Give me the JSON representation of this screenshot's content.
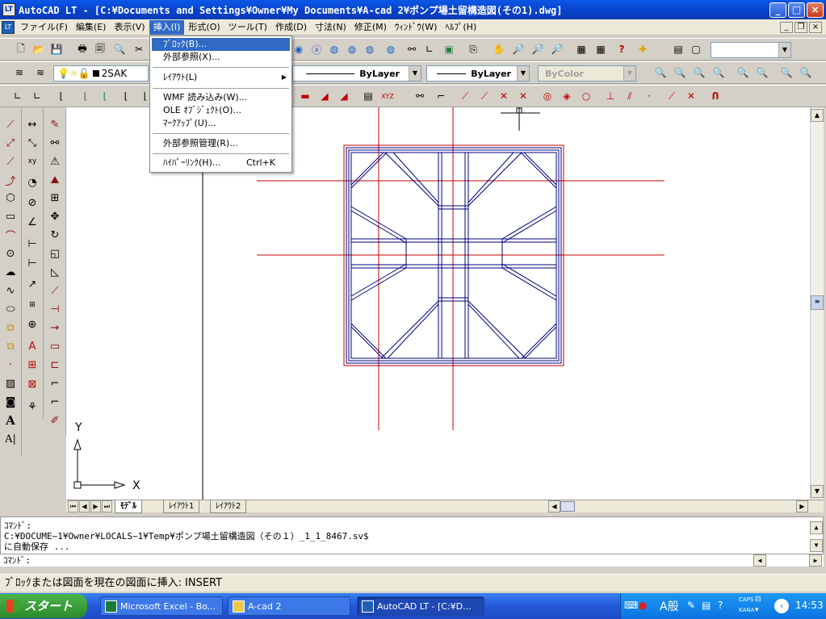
{
  "window": {
    "title": "AutoCAD LT - [C:¥Documents and Settings¥Owner¥My Documents¥A-cad 2¥ポンプ場土留構造図(その1).dwg]",
    "icon": "autocad-app-icon"
  },
  "menubar": {
    "items": [
      "ファイル(F)",
      "編集(E)",
      "表示(V)",
      "挿入(I)",
      "形式(O)",
      "ツール(T)",
      "作成(D)",
      "寸法(N)",
      "修正(M)",
      "ｳｨﾝﾄﾞｳ(W)",
      "ﾍﾙﾌﾟ(H)"
    ],
    "active_index": 3
  },
  "insert_menu": {
    "items": [
      {
        "label": "ﾌﾞﾛｯｸ(B)...",
        "highlighted": true
      },
      {
        "label": "外部参照(X)..."
      },
      {
        "label": "ﾚｲｱｳﾄ(L)",
        "submenu": true
      },
      {
        "label": "WMF 読み込み(W)..."
      },
      {
        "label": "OLE ｵﾌﾞｼﾞｪｸﾄ(O)..."
      },
      {
        "label": "ﾏｰｸｱｯﾌﾟ(U)..."
      },
      {
        "label": "外部参照管理(R)..."
      },
      {
        "label": "ﾊｲﾊﾟｰﾘﾝｸ(H)...",
        "shortcut": "Ctrl+K"
      }
    ]
  },
  "properties": {
    "layer": "2SAK",
    "linetype": "ByLayer",
    "lineweight": "ByLayer",
    "color": "ByColor"
  },
  "ucs": {
    "x_label": "X",
    "y_label": "Y"
  },
  "layout_tabs": [
    {
      "label": "ﾓﾃﾞﾙ",
      "selected": true
    },
    {
      "label": "ﾚｲｱｳﾄ1"
    },
    {
      "label": "ﾚｲｱｳﾄ2"
    }
  ],
  "command": {
    "lines": [
      "ｺﾏﾝﾄﾞ:",
      "C:¥DOCUME~1¥Owner¥LOCALS~1¥Temp¥ポンプ場土留構造図（その１）_1_1_8467.sv$",
      "に自動保存 ..."
    ],
    "prompt": "ｺﾏﾝﾄﾞ:"
  },
  "status_text": "ﾌﾞﾛｯｸまたは図面を現在の図面に挿入:  INSERT",
  "taskbar": {
    "start_label": "スタート",
    "tasks": [
      {
        "label": "Microsoft Excel - Bo...",
        "icon": "excel-icon"
      },
      {
        "label": "A-cad 2",
        "icon": "folder-icon"
      },
      {
        "label": "AutoCAD LT - [C:¥D...",
        "icon": "autocad-icon",
        "active": true
      }
    ],
    "tray": {
      "ime": "A般",
      "caps": "CAPS",
      "kana": "KANA",
      "clock": "14:53"
    }
  },
  "colors": {
    "titlebar": "#0a3cb4",
    "menu_highlight": "#316ac5",
    "drawing_line": "#000080",
    "construction_line": "#c00000",
    "taskbar": "#2458d8",
    "start_button": "#2a8a2a"
  }
}
